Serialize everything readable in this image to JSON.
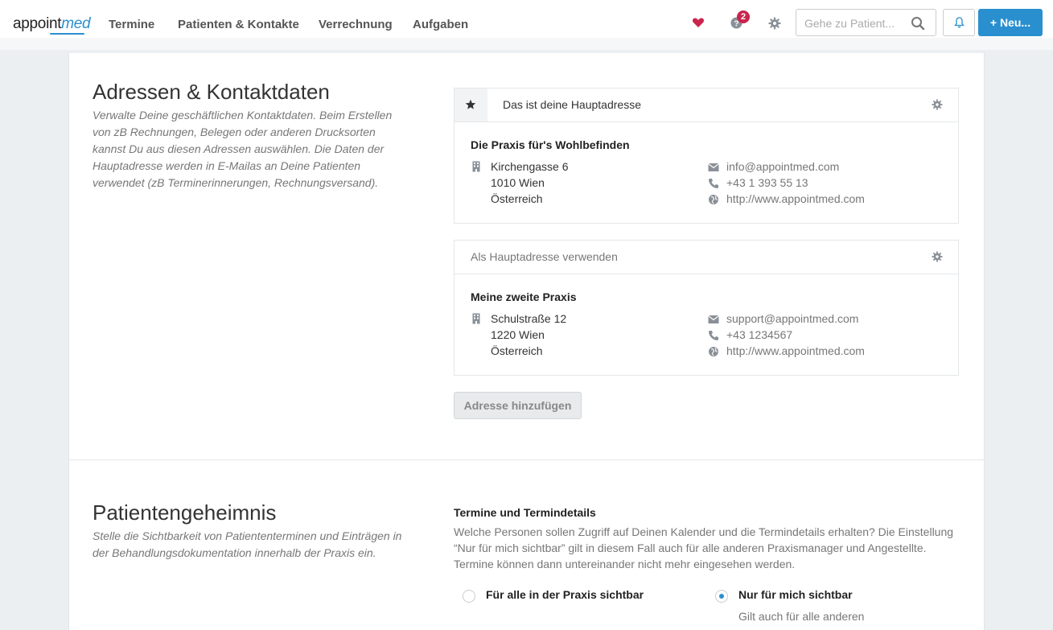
{
  "brand": {
    "logo_main": "appoint",
    "logo_accent": "med"
  },
  "nav": [
    {
      "label": "Termine"
    },
    {
      "label": "Patienten & Kontakte"
    },
    {
      "label": "Verrechnung"
    },
    {
      "label": "Aufgaben"
    }
  ],
  "header": {
    "help_badge_count": "2",
    "search_placeholder": "Gehe zu Patient...",
    "new_button_label": "+ Neu..."
  },
  "colors": {
    "accent": "#2a8fcf",
    "heart": "#c8254d",
    "badge": "#c8254d"
  },
  "addresses_section": {
    "title": "Adressen & Kontaktdaten",
    "description": "Verwalte Deine geschäftlichen Kontaktdaten. Beim Erstellen von zB Rechnungen, Belegen oder anderen Drucksorten kannst Du aus diesen Adressen auswählen. Die Daten der Hauptadresse werden in E-Mailas an Deine Patienten verwendet (zB Terminerinnerungen, Rechnungsversand).",
    "addresses": [
      {
        "header_label": "Das ist deine Hauptadresse",
        "name": "Die Praxis für's Wohlbefinden",
        "street": "Kirchengasse 6",
        "city": "1010 Wien",
        "country": "Österreich",
        "email": "info@appointmed.com",
        "phone": "+43 1 393 55 13",
        "web": "http://www.appointmed.com"
      },
      {
        "header_label": "Als Hauptadresse verwenden",
        "name": "Meine zweite Praxis",
        "street": "Schulstraße 12",
        "city": "1220 Wien",
        "country": "Österreich",
        "email": "support@appointmed.com",
        "phone": "+43 1234567",
        "web": "http://www.appointmed.com"
      }
    ],
    "add_button_label": "Adresse hinzufügen"
  },
  "privacy_section": {
    "title": "Patientengeheimnis",
    "description": "Stelle die Sichtbarkeit von Patiententerminen und Einträgen in der Behandlungsdokumentation innerhalb der Praxis ein.",
    "subheading": "Termine und Termindetails",
    "subdescription": "Welche Personen sollen Zugriff auf Deinen Kalender und die Termindetails erhalten? Die Einstellung “Nur für mich sichtbar” gilt in diesem Fall auch für alle anderen Praxismanager und Angestellte. Termine können dann untereinander nicht mehr eingesehen werden.",
    "options": [
      {
        "label": "Für alle in der Praxis sichtbar",
        "selected": false
      },
      {
        "label": "Nur für mich sichtbar",
        "selected": true,
        "note": "Gilt auch für alle anderen"
      }
    ]
  }
}
